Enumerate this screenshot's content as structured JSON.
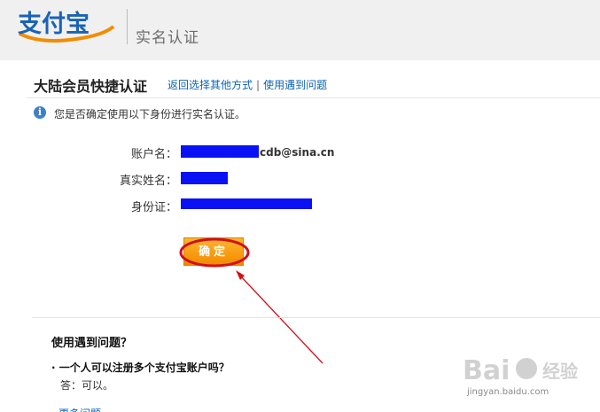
{
  "header": {
    "logo_text": "支付宝",
    "title": "实名认证"
  },
  "main": {
    "page_title": "大陆会员快捷认证",
    "links": [
      "返回选择其他方式",
      "使用遇到问题"
    ],
    "link_separator": "|",
    "info_text": "您是否确定使用以下身份进行实名认证。",
    "fields": [
      {
        "label": "账户名：",
        "value_suffix": "cdb@sina.cn"
      },
      {
        "label": "真实姓名：",
        "value_suffix": ""
      },
      {
        "label": "身份证：",
        "value_suffix": ""
      }
    ],
    "mask_color": "#0a12f5",
    "confirm_label": "确定"
  },
  "faq": {
    "title": "使用遇到问题？",
    "question": "· 一个人可以注册多个支付宝账户吗？",
    "answer": "答：可以。",
    "more_link": "更多问题"
  },
  "watermark": {
    "brand": "Bai经验",
    "sub": "jingyan.baidu.com"
  },
  "colors": {
    "accent": "#0c64b5",
    "annotation": "#d0101a",
    "button": "#f18a00"
  }
}
